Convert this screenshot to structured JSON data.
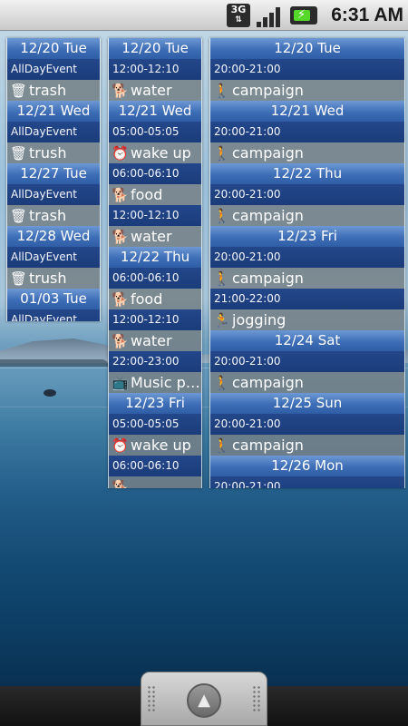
{
  "statusbar": {
    "network": "3G",
    "time": "6:31 AM"
  },
  "columns": [
    {
      "rows": [
        {
          "kind": "date",
          "text": "12/20 Tue"
        },
        {
          "kind": "time",
          "text": "AllDayEvent"
        },
        {
          "kind": "event",
          "icon": "trash-can-icon",
          "glyph": "🗑",
          "text": "trash"
        },
        {
          "kind": "date",
          "text": "12/21 Wed"
        },
        {
          "kind": "time",
          "text": "AllDayEvent"
        },
        {
          "kind": "event",
          "icon": "trash-can-icon",
          "glyph": "🗑",
          "text": "trush"
        },
        {
          "kind": "date",
          "text": "12/27 Tue"
        },
        {
          "kind": "time",
          "text": "AllDayEvent"
        },
        {
          "kind": "event",
          "icon": "trash-can-icon",
          "glyph": "🗑",
          "text": "trash"
        },
        {
          "kind": "date",
          "text": "12/28 Wed"
        },
        {
          "kind": "time",
          "text": "AllDayEvent"
        },
        {
          "kind": "event",
          "icon": "trash-can-icon",
          "glyph": "🗑",
          "text": "trush"
        },
        {
          "kind": "date",
          "text": "01/03 Tue"
        },
        {
          "kind": "time",
          "text": "AllDayEvent"
        }
      ]
    },
    {
      "rows": [
        {
          "kind": "date",
          "text": "12/20 Tue"
        },
        {
          "kind": "time",
          "text": "12:00-12:10"
        },
        {
          "kind": "event",
          "icon": "dog-icon",
          "glyph": "🐕",
          "text": "water"
        },
        {
          "kind": "date",
          "text": "12/21 Wed"
        },
        {
          "kind": "time",
          "text": "05:00-05:05"
        },
        {
          "kind": "event",
          "icon": "alarm-clock-icon",
          "glyph": "⏰",
          "text": "wake up"
        },
        {
          "kind": "time",
          "text": "06:00-06:10"
        },
        {
          "kind": "event",
          "icon": "dog-icon",
          "glyph": "🐕",
          "text": "food"
        },
        {
          "kind": "time",
          "text": "12:00-12:10"
        },
        {
          "kind": "event",
          "icon": "dog-icon",
          "glyph": "🐕",
          "text": "water"
        },
        {
          "kind": "date",
          "text": "12/22 Thu"
        },
        {
          "kind": "time",
          "text": "06:00-06:10"
        },
        {
          "kind": "event",
          "icon": "dog-icon",
          "glyph": "🐕",
          "text": "food"
        },
        {
          "kind": "time",
          "text": "12:00-12:10"
        },
        {
          "kind": "event",
          "icon": "dog-icon",
          "glyph": "🐕",
          "text": "water"
        },
        {
          "kind": "time",
          "text": "22:00-23:00"
        },
        {
          "kind": "event",
          "icon": "tv-icon",
          "glyph": "📺",
          "text": "Music pr..."
        },
        {
          "kind": "date",
          "text": "12/23 Fri"
        },
        {
          "kind": "time",
          "text": "05:00-05:05"
        },
        {
          "kind": "event",
          "icon": "alarm-clock-icon",
          "glyph": "⏰",
          "text": "wake up"
        },
        {
          "kind": "time",
          "text": "06:00-06:10"
        },
        {
          "kind": "event",
          "icon": "dog-icon",
          "glyph": "🐕",
          "text": ""
        }
      ]
    },
    {
      "rows": [
        {
          "kind": "date",
          "text": "12/20 Tue"
        },
        {
          "kind": "time",
          "text": "20:00-21:00"
        },
        {
          "kind": "event",
          "icon": "campaign-person-icon",
          "glyph": "🚶",
          "text": "campaign"
        },
        {
          "kind": "date",
          "text": "12/21 Wed"
        },
        {
          "kind": "time",
          "text": "20:00-21:00"
        },
        {
          "kind": "event",
          "icon": "campaign-person-icon",
          "glyph": "🚶",
          "text": "campaign"
        },
        {
          "kind": "date",
          "text": "12/22 Thu"
        },
        {
          "kind": "time",
          "text": "20:00-21:00"
        },
        {
          "kind": "event",
          "icon": "campaign-person-icon",
          "glyph": "🚶",
          "text": "campaign"
        },
        {
          "kind": "date",
          "text": "12/23 Fri"
        },
        {
          "kind": "time",
          "text": "20:00-21:00"
        },
        {
          "kind": "event",
          "icon": "campaign-person-icon",
          "glyph": "🚶",
          "text": "campaign"
        },
        {
          "kind": "time",
          "text": "21:00-22:00"
        },
        {
          "kind": "event",
          "icon": "jogging-icon",
          "glyph": "🏃",
          "text": "jogging"
        },
        {
          "kind": "date",
          "text": "12/24 Sat"
        },
        {
          "kind": "time",
          "text": "20:00-21:00"
        },
        {
          "kind": "event",
          "icon": "campaign-person-icon",
          "glyph": "🚶",
          "text": "campaign"
        },
        {
          "kind": "date",
          "text": "12/25 Sun"
        },
        {
          "kind": "time",
          "text": "20:00-21:00"
        },
        {
          "kind": "event",
          "icon": "campaign-person-icon",
          "glyph": "🚶",
          "text": "campaign"
        },
        {
          "kind": "date",
          "text": "12/26 Mon"
        },
        {
          "kind": "time",
          "text": "20:00-21:00"
        }
      ]
    }
  ],
  "dock": {
    "drawer_icon": "app-drawer-up-icon"
  }
}
